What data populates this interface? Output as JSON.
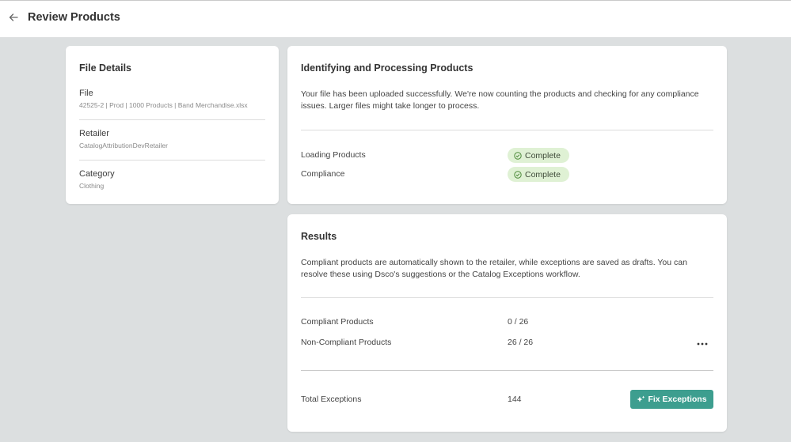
{
  "header": {
    "title": "Review Products"
  },
  "file_details": {
    "title": "File Details",
    "fields": [
      {
        "label": "File",
        "value": "42525-2 | Prod | 1000 Products | Band Merchandise.xlsx"
      },
      {
        "label": "Retailer",
        "value": "CatalogAttributionDevRetailer"
      },
      {
        "label": "Category",
        "value": "Clothing"
      }
    ]
  },
  "processing": {
    "title": "Identifying and Processing Products",
    "description": "Your file has been uploaded successfully. We're now counting the products and checking for any compliance issues. Larger files might take longer to process.",
    "steps": [
      {
        "label": "Loading Products",
        "status": "Complete"
      },
      {
        "label": "Compliance",
        "status": "Complete"
      }
    ],
    "status_color": "#dff1d4"
  },
  "results": {
    "title": "Results",
    "description": "Compliant products are automatically shown to the retailer, while exceptions are saved as drafts. You can resolve these using Dsco's suggestions or the Catalog Exceptions workflow.",
    "rows": [
      {
        "label": "Compliant Products",
        "value": "0 / 26"
      },
      {
        "label": "Non-Compliant Products",
        "value": "26 / 26"
      }
    ],
    "more_icon": "more-horizontal-icon",
    "total": {
      "label": "Total Exceptions",
      "value": "144"
    },
    "fix_button_label": "Fix Exceptions",
    "button_color": "#3d9e8f"
  }
}
